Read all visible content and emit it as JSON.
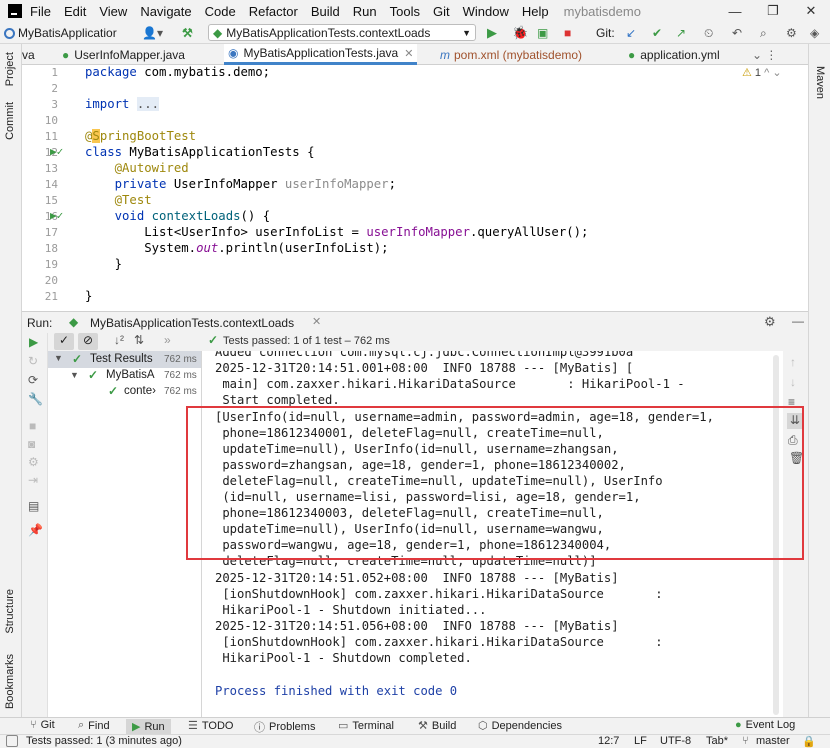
{
  "menu": {
    "items": [
      "File",
      "Edit",
      "View",
      "Navigate",
      "Code",
      "Refactor",
      "Build",
      "Run",
      "Tools",
      "Git",
      "Window",
      "Help"
    ],
    "project_name": "mybatisdemo",
    "window_controls": [
      "—",
      "❐",
      "✕"
    ]
  },
  "toolbar": {
    "project_selector": "MyBatisApplicatior",
    "run_config": "MyBatisApplicationTests.contextLoads",
    "git_label": "Git:"
  },
  "tabs": [
    {
      "label": "va",
      "active": false
    },
    {
      "label": "UserInfoMapper.java",
      "active": false
    },
    {
      "label": "MyBatisApplicationTests.java",
      "active": true
    },
    {
      "label": "pom.xml (mybatisdemo)",
      "active": false
    },
    {
      "label": "application.yml",
      "active": false
    }
  ],
  "left_strip": [
    "Project",
    "Commit",
    "Structure",
    "Bookmarks"
  ],
  "right_strip": [
    "Maven"
  ],
  "editor": {
    "warning_count": "1",
    "lines": [
      {
        "num": "1",
        "text": "package com.mybatis.demo;"
      },
      {
        "num": "2",
        "text": ""
      },
      {
        "num": "3",
        "text": "import ..."
      },
      {
        "num": "10",
        "text": ""
      },
      {
        "num": "11",
        "text": "@SpringBootTest"
      },
      {
        "num": "12",
        "text": "class MyBatisApplicationTests {"
      },
      {
        "num": "13",
        "text": "    @Autowired"
      },
      {
        "num": "14",
        "text": "    private UserInfoMapper userInfoMapper;"
      },
      {
        "num": "15",
        "text": "    @Test"
      },
      {
        "num": "16",
        "text": "    void contextLoads() {"
      },
      {
        "num": "17",
        "text": "        List<UserInfo> userInfoList = userInfoMapper.queryAllUser();"
      },
      {
        "num": "18",
        "text": "        System.out.println(userInfoList);"
      },
      {
        "num": "19",
        "text": "    }"
      },
      {
        "num": "20",
        "text": ""
      },
      {
        "num": "21",
        "text": "}"
      }
    ]
  },
  "run": {
    "label": "Run:",
    "tab_title": "MyBatisApplicationTests.contextLoads",
    "status": "Tests passed: 1 of 1 test – 762 ms",
    "tree": [
      {
        "label": "Test Results",
        "time": "762 ms"
      },
      {
        "label": "MyBatisA",
        "time": "762 ms"
      },
      {
        "label": "conte›",
        "time": "762 ms"
      }
    ],
    "console": [
      "Added connection com.mysql.cj.jdbc.ConnectionImpl@3991b0a",
      "2025-12-31T20:14:51.001+08:00  INFO 18788 --- [MyBatis] [",
      " main] com.zaxxer.hikari.HikariDataSource       : HikariPool-1 -",
      " Start completed.",
      "[UserInfo(id=null, username=admin, password=admin, age=18, gender=1,",
      " phone=18612340001, deleteFlag=null, createTime=null,",
      " updateTime=null), UserInfo(id=null, username=zhangsan,",
      " password=zhangsan, age=18, gender=1, phone=18612340002,",
      " deleteFlag=null, createTime=null, updateTime=null), UserInfo",
      " (id=null, username=lisi, password=lisi, age=18, gender=1,",
      " phone=18612340003, deleteFlag=null, createTime=null,",
      " updateTime=null), UserInfo(id=null, username=wangwu,",
      " password=wangwu, age=18, gender=1, phone=18612340004,",
      " deleteFlag=null, createTime=null, updateTime=null)]",
      "2025-12-31T20:14:51.052+08:00  INFO 18788 --- [MyBatis]",
      " [ionShutdownHook] com.zaxxer.hikari.HikariDataSource       :",
      " HikariPool-1 - Shutdown initiated...",
      "2025-12-31T20:14:51.056+08:00  INFO 18788 --- [MyBatis]",
      " [ionShutdownHook] com.zaxxer.hikari.HikariDataSource       :",
      " HikariPool-1 - Shutdown completed.",
      "",
      "Process finished with exit code 0"
    ]
  },
  "bottom_tools": [
    "Git",
    "Find",
    "Run",
    "TODO",
    "Problems",
    "Terminal",
    "Build",
    "Dependencies",
    "Event Log"
  ],
  "status": {
    "message": "Tests passed: 1 (3 minutes ago)",
    "position": "12:7",
    "line_sep": "LF",
    "encoding": "UTF-8",
    "indent": "Tab*",
    "branch": "master"
  },
  "colors": {
    "keyword": "#0033b3",
    "annotation": "#9e880d",
    "field": "#871094",
    "pass": "#3c9a45",
    "highlight_box": "#e0393e"
  }
}
